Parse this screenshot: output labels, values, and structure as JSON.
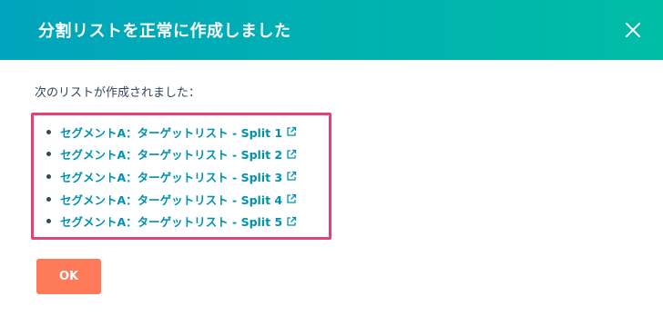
{
  "dialog": {
    "title": "分割リストを正常に作成しました",
    "intro_text": "次のリストが作成されました：",
    "lists": [
      {
        "label": "セグメントA：ターゲットリスト - Split 1"
      },
      {
        "label": "セグメントA：ターゲットリスト - Split 2"
      },
      {
        "label": "セグメントA：ターゲットリスト - Split 3"
      },
      {
        "label": "セグメントA：ターゲットリスト - Split 4"
      },
      {
        "label": "セグメントA：ターゲットリスト - Split 5"
      }
    ],
    "ok_label": "OK",
    "icons": {
      "close": "close-icon",
      "external": "external-link-icon"
    }
  },
  "colors": {
    "header_start": "#00a4bd",
    "header_end": "#00bda5",
    "link": "#0091ae",
    "highlight_border": "#e0427a",
    "ok_button": "#ff7a59"
  }
}
